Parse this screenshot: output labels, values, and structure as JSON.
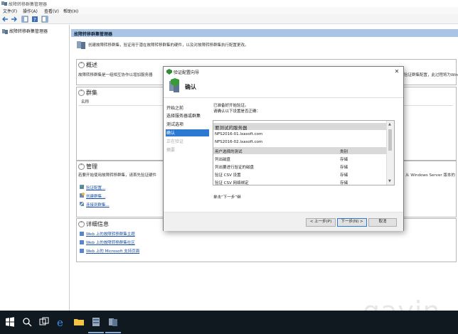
{
  "window": {
    "title": "故障转移群集管理器"
  },
  "menu": [
    "文件(F)",
    "操作(A)",
    "查看(V)",
    "帮助(H)"
  ],
  "tree": {
    "root_label": "故障转移群集管理器"
  },
  "content": {
    "header": "故障转移群集管理器",
    "intro": "创建故障转移群集，验证用于潜在故障转移群集的硬件，以及对故障转移群集执行配置更改。",
    "overview": {
      "title": "概述",
      "text": "故障转移群集是一组相互协作以增加服务器",
      "text_right": "验证群集配置，此过程将为Win"
    },
    "clusters": {
      "title": "群集",
      "col_name": "名称"
    },
    "management": {
      "title": "管理",
      "text": "若要开始使用故障转移群集，请首先验证硬件",
      "text_right": "从 Windows Server 版本的",
      "links": [
        "验证配置...",
        "创建群集...",
        "连接到群集..."
      ]
    },
    "details": {
      "title": "详细信息",
      "links": [
        "Web 上的故障转移群集主题",
        "Web 上的故障转移群集社区",
        "Web 上的 Microsoft 支持页面"
      ]
    }
  },
  "dialog": {
    "title": "验证配置向导",
    "close_glyph": "✕",
    "heading": "确认",
    "steps": [
      {
        "label": "开始之前",
        "state": "normal"
      },
      {
        "label": "选择服务器或群集",
        "state": "normal"
      },
      {
        "label": "测试选项",
        "state": "normal"
      },
      {
        "label": "确认",
        "state": "active"
      },
      {
        "label": "正在验证",
        "state": "disabled"
      },
      {
        "label": "摘要",
        "state": "disabled"
      }
    ],
    "ready_text": "已准备好开始验证。",
    "confirm_text": "请确认以下设置是否正确：",
    "servers_header": "要测试的服务器",
    "servers": [
      "NFS2016-01.lxasoft.com",
      "NFS2016-02.lxasoft.com"
    ],
    "tests_header": {
      "col1": "用户选择的测试",
      "col2": "类别"
    },
    "tests": [
      {
        "name": "列出磁盘",
        "category": "存储"
      },
      {
        "name": "列出要进行验证的磁盘",
        "category": "存储"
      },
      {
        "name": "验证 CSV 设置",
        "category": "存储"
      },
      {
        "name": "验证 CSV 网络绑定",
        "category": "存储"
      }
    ],
    "next_hint": "单击“下一步”继",
    "buttons": {
      "prev": "< 上一步(P)",
      "next": "下一步(N) >",
      "cancel": "取消"
    }
  },
  "watermark": "gavin",
  "colors": {
    "accent": "#2b79d0",
    "header_band": "#a9c4e4",
    "taskbar": "#101820"
  },
  "icons": [
    "cluster-icon",
    "back-arrow-icon",
    "forward-arrow-icon",
    "wizard-shield-icon",
    "windows-start-icon",
    "search-icon",
    "task-view-icon",
    "edge-icon",
    "file-explorer-icon",
    "server-manager-icon",
    "cluster-manager-icon"
  ]
}
